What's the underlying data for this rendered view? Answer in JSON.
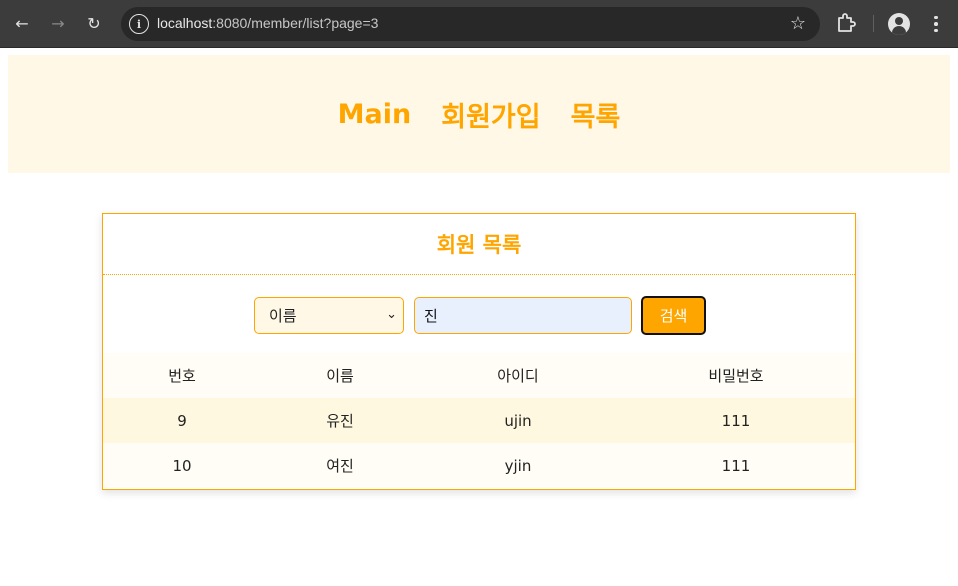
{
  "browser": {
    "url_host": "localhost",
    "url_rest": ":8080/member/list?page=3"
  },
  "nav": {
    "items": [
      "Main",
      "회원가입",
      "목록"
    ]
  },
  "card": {
    "title": "회원 목록",
    "search": {
      "field_selected": "이름",
      "query": "진",
      "button_label": "검색"
    },
    "table": {
      "headers": [
        "번호",
        "이름",
        "아이디",
        "비밀번호"
      ],
      "rows": [
        [
          "9",
          "유진",
          "ujin",
          "111"
        ],
        [
          "10",
          "여진",
          "yjin",
          "111"
        ]
      ]
    }
  },
  "colors": {
    "accent": "#ffa500",
    "header_bg": "#fff8e7"
  }
}
